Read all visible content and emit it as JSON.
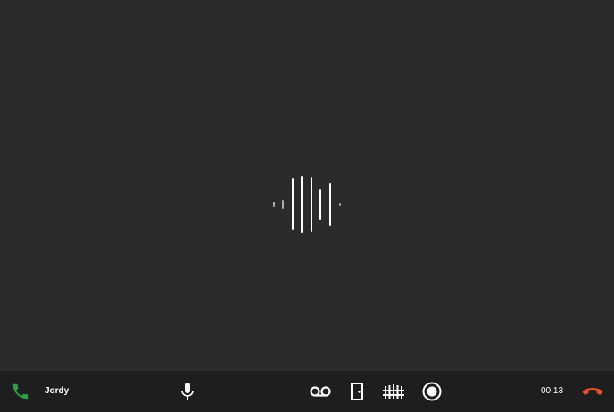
{
  "call": {
    "caller_name": "Jordy",
    "duration": "00:13",
    "status_icon": "phone-icon",
    "status_color": "#2ea043"
  },
  "visualizer": {
    "levels": [
      0.1,
      0.15,
      0.9,
      1.0,
      0.95,
      0.55,
      0.75,
      0.05
    ]
  },
  "controls": {
    "microphone_icon": "microphone-icon",
    "voicemail_icon": "voicemail-icon",
    "door_icon": "door-icon",
    "gate_icon": "gate-icon",
    "record_icon": "record-icon",
    "hangup_icon": "hangup-icon",
    "hangup_color": "#e8502a"
  }
}
